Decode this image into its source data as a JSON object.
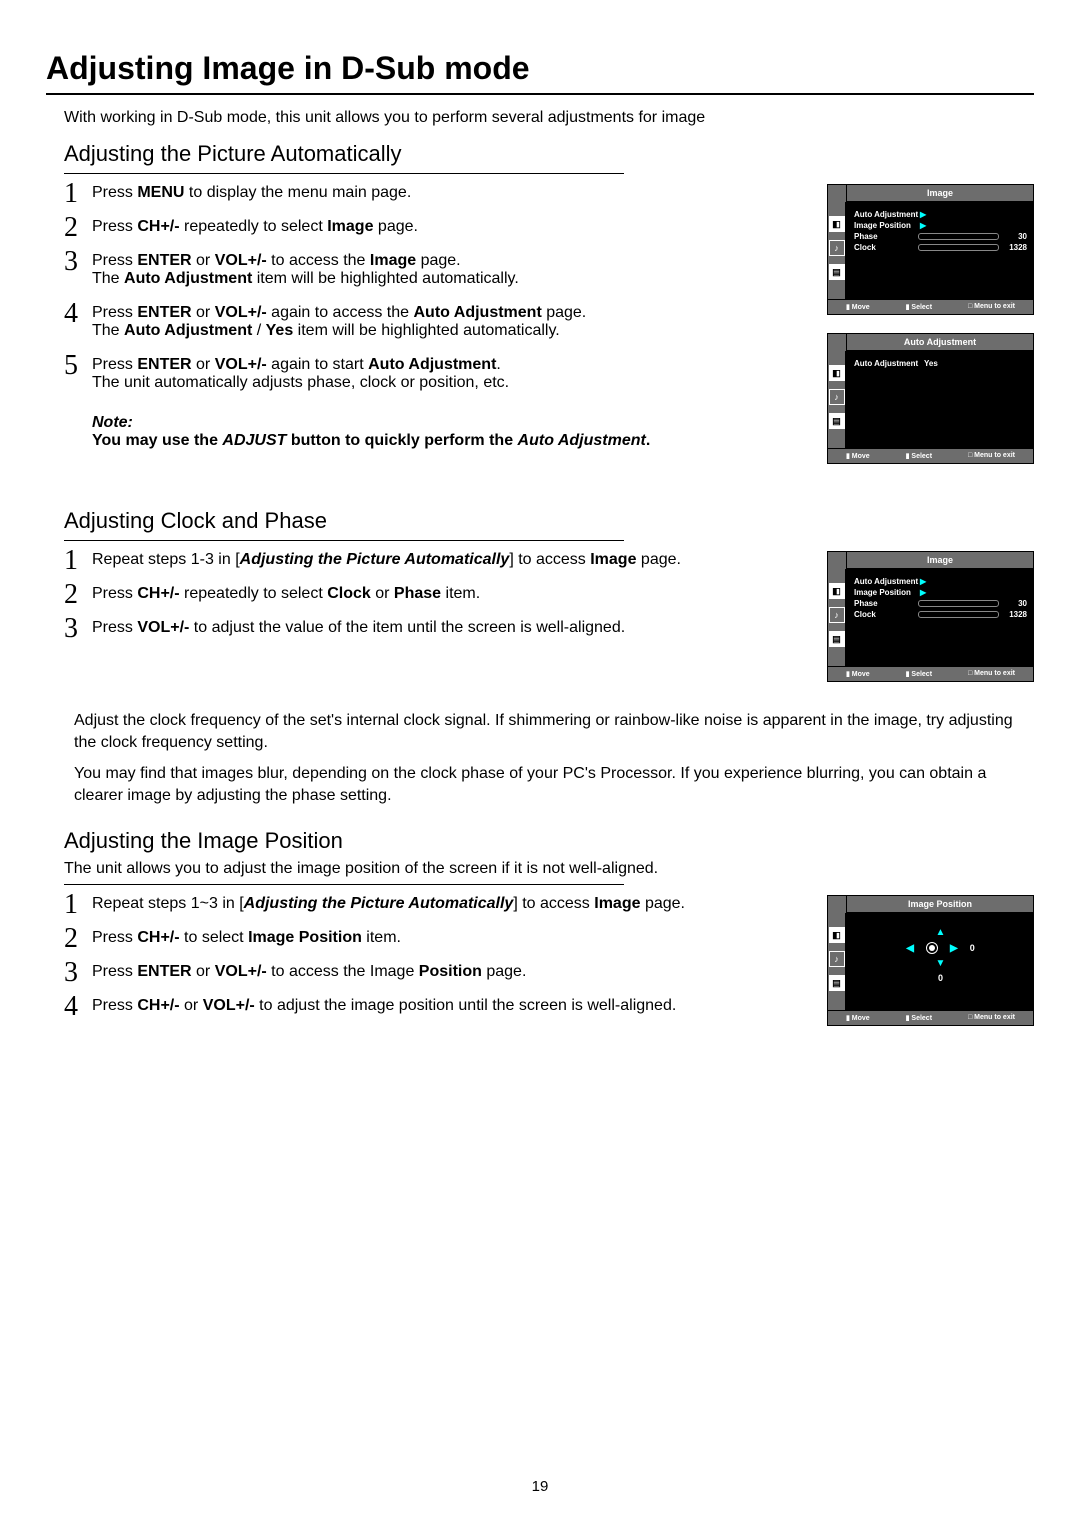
{
  "page": {
    "title": "Adjusting Image in D-Sub mode",
    "intro": "With working in D-Sub mode, this unit allows you to perform several adjustments for image",
    "number": "19"
  },
  "auto": {
    "heading": "Adjusting the Picture Automatically",
    "s1a": "Press ",
    "s1b": "MENU",
    "s1c": " to display the menu main page.",
    "s2a": "Press ",
    "s2b": "CH+/-",
    "s2c": " repeatedly to select ",
    "s2d": "Image",
    "s2e": " page.",
    "s3a": "Press ",
    "s3b": "ENTER",
    "s3c": " or ",
    "s3d": "VOL+/-",
    "s3e": " to access the ",
    "s3f": "Image",
    "s3g": " page.",
    "s3h": "The ",
    "s3i": "Auto Adjustment",
    "s3j": " item will be highlighted automatically.",
    "s4a": "Press ",
    "s4b": "ENTER",
    "s4c": " or ",
    "s4d": "VOL+/-",
    "s4e": " again to access the ",
    "s4f": "Auto Adjustment",
    "s4g": " page.",
    "s4h": "The ",
    "s4i": "Auto Adjustment",
    "s4j": " / ",
    "s4k": "Yes",
    "s4l": " item will be highlighted automatically.",
    "s5a": "Press ",
    "s5b": "ENTER",
    "s5c": " or ",
    "s5d": "VOL+/-",
    "s5e": " again to start ",
    "s5f": "Auto Adjustment",
    "s5g": ".",
    "s5h": "The unit automatically adjusts phase, clock or position, etc.",
    "note_label": "Note:",
    "note_a": "You may use the ",
    "note_b": "ADJUST",
    "note_c": " button to quickly perform the ",
    "note_d": "Auto Adjustment",
    "note_e": "."
  },
  "clock": {
    "heading": "Adjusting Clock and Phase",
    "s1a": "Repeat steps 1-3 in [",
    "s1b": "Adjusting the Picture Automatically",
    "s1c": "] to access ",
    "s1d": "Image",
    "s1e": " page.",
    "s2a": "Press ",
    "s2b": "CH+/-",
    "s2c": " repeatedly to select ",
    "s2d": "Clock",
    "s2e": " or ",
    "s2f": "Phase",
    "s2g": " item.",
    "s3a": "Press ",
    "s3b": "VOL+/-",
    "s3c": " to adjust the value of the item until the screen is well-aligned.",
    "p1": "Adjust the clock frequency of the set's internal clock signal. If shimmering or rainbow-like noise is apparent in the image, try adjusting the clock frequency setting.",
    "p2": "You may find that images blur, depending on the clock phase of your PC's Processor. If you experience blurring, you can obtain a clearer image by adjusting the phase setting."
  },
  "pos": {
    "heading": "Adjusting the Image Position",
    "intro": "The unit allows you to adjust the image position of the screen if it is not well-aligned.",
    "s1a": "Repeat steps 1~3 in [",
    "s1b": "Adjusting the Picture Automatically",
    "s1c": "] to access ",
    "s1d": "Image",
    "s1e": " page.",
    "s2a": "Press ",
    "s2b": "CH+/-",
    "s2c": " to select ",
    "s2d": "Image Position",
    "s2e": " item.",
    "s3a": "Press ",
    "s3b": "ENTER",
    "s3c": " or ",
    "s3d": "VOL+/-",
    "s3e": " to access the Image ",
    "s3f": "Position",
    "s3g": " page.",
    "s4a": "Press ",
    "s4b": "CH+/-",
    "s4c": " or ",
    "s4d": "VOL+/-",
    "s4e": " to adjust the image position until the screen is well-aligned."
  },
  "osd": {
    "title_image": "Image",
    "title_auto": "Auto Adjustment",
    "title_pos": "Image Position",
    "items": {
      "auto": "Auto Adjustment",
      "imgpos": "Image Position",
      "phase": "Phase",
      "clock": "Clock",
      "yes": "Yes"
    },
    "values": {
      "phase": "30",
      "clock": "1328",
      "posx": "0",
      "posy": "0"
    },
    "footer": {
      "move": "Move",
      "select": "Select",
      "exit": "Menu to exit"
    }
  }
}
